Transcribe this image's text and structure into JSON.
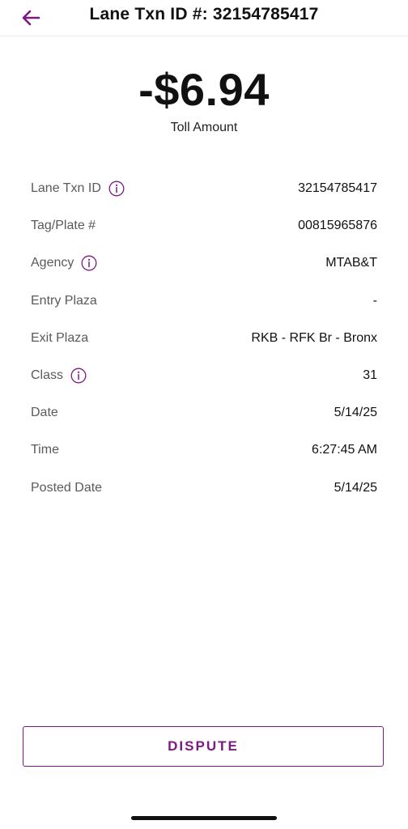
{
  "header": {
    "title": "Lane Txn ID #: 32154785417",
    "back_icon": "arrow-left-icon"
  },
  "amount": {
    "value": "-$6.94",
    "label": "Toll Amount"
  },
  "details": [
    {
      "label": "Lane Txn ID",
      "value": "32154785417",
      "info": true
    },
    {
      "label": "Tag/Plate #",
      "value": "00815965876",
      "info": false
    },
    {
      "label": "Agency",
      "value": "MTAB&T",
      "info": true
    },
    {
      "label": "Entry Plaza",
      "value": "-",
      "info": false
    },
    {
      "label": "Exit Plaza",
      "value": "RKB - RFK Br - Bronx",
      "info": false
    },
    {
      "label": "Class",
      "value": "31",
      "info": true
    },
    {
      "label": "Date",
      "value": "5/14/25",
      "info": false
    },
    {
      "label": "Time",
      "value": "6:27:45 AM",
      "info": false
    },
    {
      "label": "Posted Date",
      "value": "5/14/25",
      "info": false
    }
  ],
  "dispute_label": "DISPUTE",
  "colors": {
    "accent": "#7b1a82"
  }
}
